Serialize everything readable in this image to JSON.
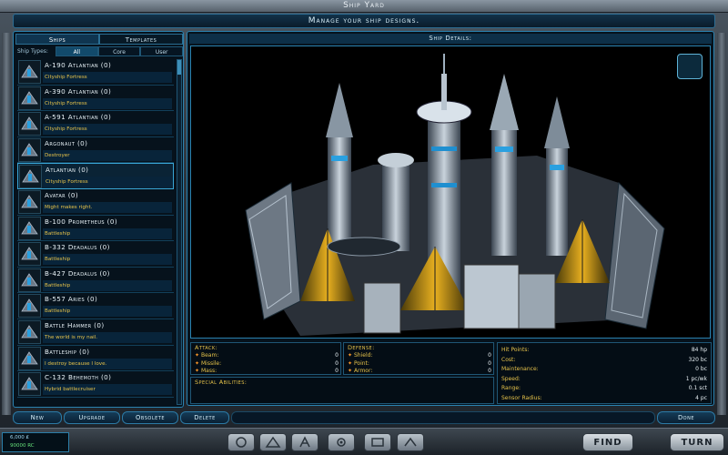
{
  "window": {
    "title": "Ship Yard",
    "subtitle": "Manage your ship designs."
  },
  "left_panel": {
    "tabs": [
      {
        "label": "Ships",
        "active": true
      },
      {
        "label": "Templates",
        "active": false
      }
    ],
    "ship_types_label": "Ship Types:",
    "type_filters": [
      {
        "label": "All",
        "active": true
      },
      {
        "label": "Core",
        "active": false
      },
      {
        "label": "User",
        "active": false
      }
    ],
    "ships": [
      {
        "name": "A-190 Atlantian (0)",
        "desc": "Cityship Fortress",
        "icon": "cityship-icon"
      },
      {
        "name": "A-390 Atlantian (0)",
        "desc": "Cityship Fortress",
        "icon": "cityship-icon"
      },
      {
        "name": "A-591 Atlantian (0)",
        "desc": "Cityship Fortress",
        "icon": "cityship-icon"
      },
      {
        "name": "Argonaut (0)",
        "desc": "Destroyer",
        "icon": "destroyer-icon"
      },
      {
        "name": "Atlantian (0)",
        "desc": "Cityship Fortress",
        "icon": "cityship-icon",
        "selected": true
      },
      {
        "name": "Avatar (0)",
        "desc": "Might makes right.",
        "icon": "warship-icon"
      },
      {
        "name": "B-100 Prometheus (0)",
        "desc": "Battleship",
        "icon": "battleship-icon"
      },
      {
        "name": "B-332 Deadalus (0)",
        "desc": "Battleship",
        "icon": "battleship-icon"
      },
      {
        "name": "B-427 Deadalus (0)",
        "desc": "Battleship",
        "icon": "battleship-icon"
      },
      {
        "name": "B-557 Aries (0)",
        "desc": "Battleship",
        "icon": "battleship-icon"
      },
      {
        "name": "Battle Hammer (0)",
        "desc": "The world is my nail.",
        "icon": "warship-icon"
      },
      {
        "name": "Battleship (0)",
        "desc": "I destroy because I love.",
        "icon": "battleship-icon"
      },
      {
        "name": "C-132 Behemoth (0)",
        "desc": "Hybrid battlecruiser",
        "icon": "battlecruiser-icon"
      }
    ]
  },
  "right_panel": {
    "header": "Ship Details:",
    "attack": {
      "title": "Attack:",
      "rows": [
        {
          "label": "Beam:",
          "value": "0",
          "icon": "beam-icon"
        },
        {
          "label": "Missile:",
          "value": "0",
          "icon": "missile-icon"
        },
        {
          "label": "Mass:",
          "value": "0",
          "icon": "mass-icon"
        }
      ]
    },
    "defense": {
      "title": "Defense:",
      "rows": [
        {
          "label": "Shield:",
          "value": "0",
          "icon": "shield-icon"
        },
        {
          "label": "Point:",
          "value": "0",
          "icon": "point-defense-icon"
        },
        {
          "label": "Armor:",
          "value": "0",
          "icon": "armor-icon"
        }
      ]
    },
    "special": {
      "title": "Special Abilities:"
    },
    "info": [
      {
        "label": "Hit Points:",
        "value": "84 hp"
      },
      {
        "label": "Cost:",
        "value": "320 bc"
      },
      {
        "label": "Maintenance:",
        "value": "0 bc"
      },
      {
        "label": "Speed:",
        "value": "1 pc/wk"
      },
      {
        "label": "Range:",
        "value": "0.1 sct"
      },
      {
        "label": "Sensor Radius:",
        "value": "4 pc"
      }
    ]
  },
  "bottom_buttons": {
    "new": "New",
    "upgrade": "Upgrade",
    "obsolete": "Obsolete",
    "delete": "Delete",
    "done": "Done"
  },
  "footer": {
    "credits": "6,000 ₤",
    "income": "90000 RC",
    "find": "FIND",
    "turn": "TURN"
  },
  "colors": {
    "accent": "#2a82b0",
    "highlight": "#e7c34a",
    "panel": "#06121c"
  }
}
